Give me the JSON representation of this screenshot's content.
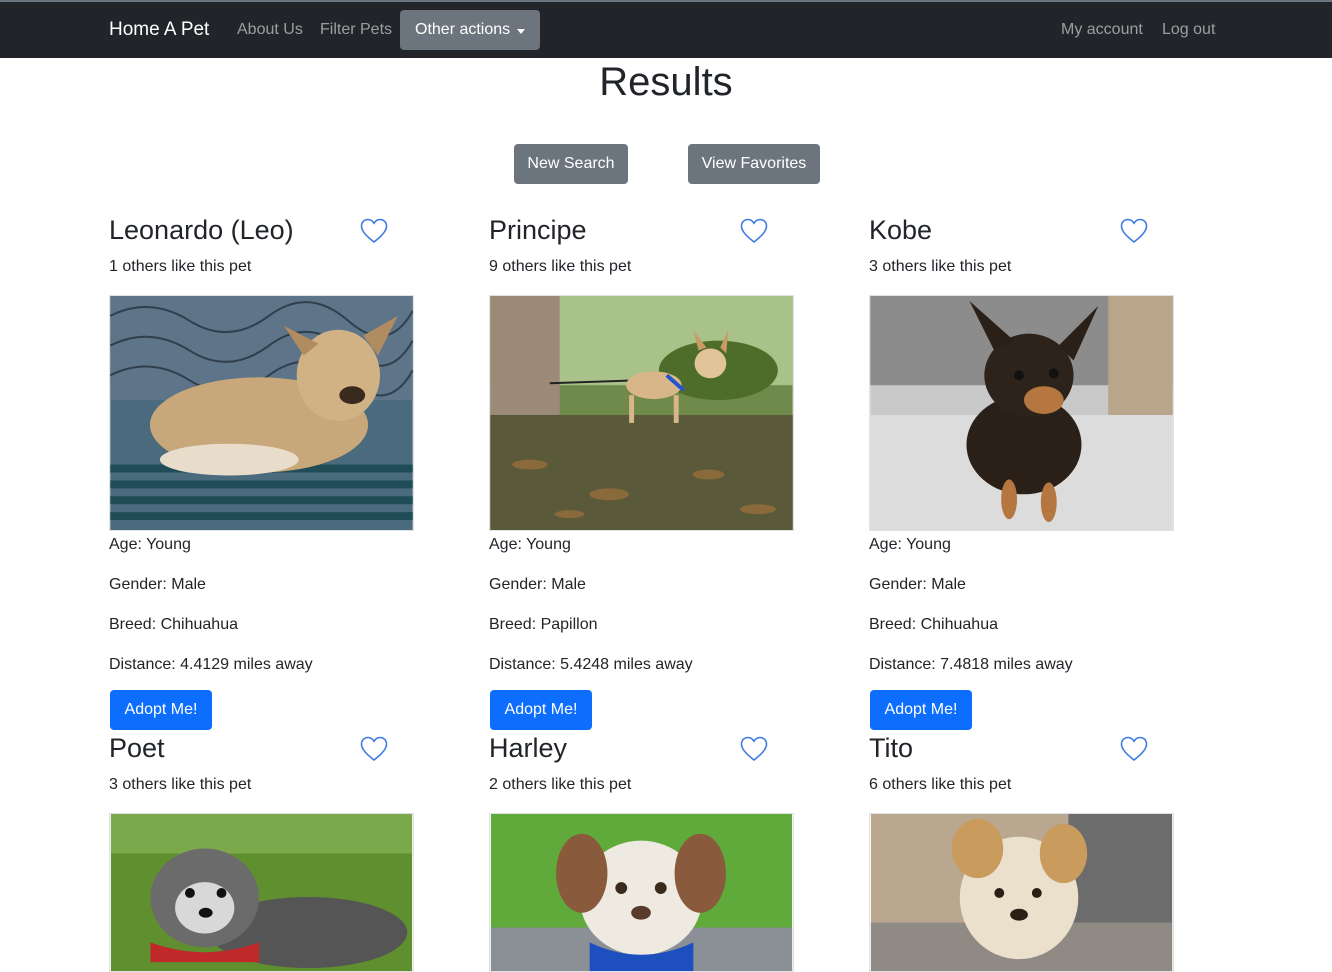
{
  "navbar": {
    "brand": "Home A Pet",
    "links": [
      "About Us",
      "Filter Pets"
    ],
    "dropdown_label": "Other actions",
    "right_links": [
      "My account",
      "Log out"
    ]
  },
  "page": {
    "title": "Results",
    "new_search": "New Search",
    "view_favorites": "View Favorites"
  },
  "pets": [
    {
      "name": "Leonardo (Leo)",
      "likes": "1 others like this pet",
      "age": "Age: Young",
      "gender": "Gender: Male",
      "breed": "Breed: Chihuahua",
      "distance": "Distance: 4.4129 miles away",
      "adopt": "Adopt Me!"
    },
    {
      "name": "Principe",
      "likes": "9 others like this pet",
      "age": "Age: Young",
      "gender": "Gender: Male",
      "breed": "Breed: Papillon",
      "distance": "Distance: 5.4248 miles away",
      "adopt": "Adopt Me!"
    },
    {
      "name": "Kobe",
      "likes": "3 others like this pet",
      "age": "Age: Young",
      "gender": "Gender: Male",
      "breed": "Breed: Chihuahua",
      "distance": "Distance: 7.4818 miles away",
      "adopt": "Adopt Me!"
    },
    {
      "name": "Poet",
      "likes": "3 others like this pet"
    },
    {
      "name": "Harley",
      "likes": "2 others like this pet"
    },
    {
      "name": "Tito",
      "likes": "6 others like this pet"
    }
  ],
  "colors": {
    "navbar_bg": "#212529",
    "secondary_button": "#6c757d",
    "primary_button": "#0d6efd",
    "heart_outline": "#3d7be0"
  },
  "icons": {
    "favorite": "heart-outline-icon",
    "dropdown": "caret-down-icon"
  }
}
